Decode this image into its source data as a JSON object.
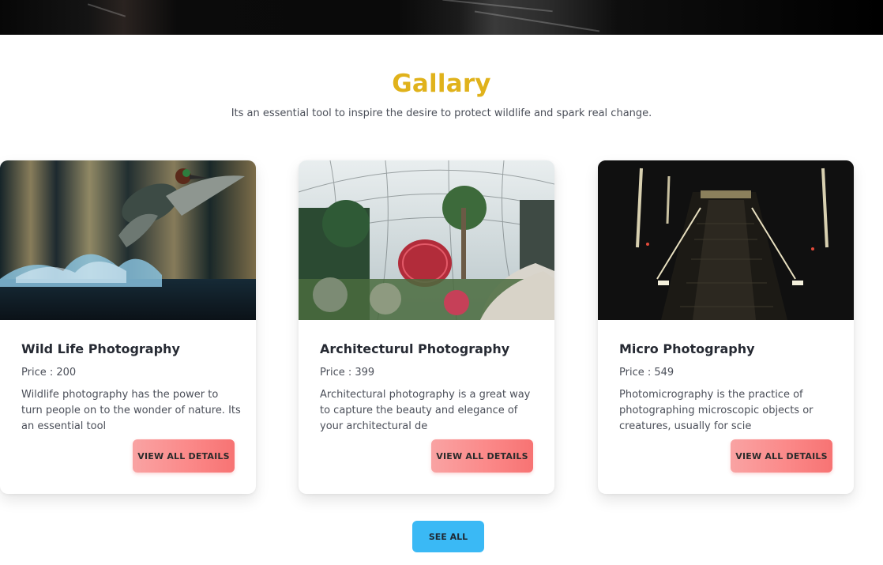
{
  "gallery": {
    "title": "Gallary",
    "subtitle": "Its an essential tool to inspire the desire to protect wildlife and spark real change."
  },
  "cards": [
    {
      "title": "Wild Life Photography",
      "price": "Price : 200",
      "description": "Wildlife photography has the power to turn people on to the wonder of nature. Its an essential tool",
      "button_label": "VIEW ALL DETAILS",
      "image": "duck-splash-photo"
    },
    {
      "title": "Architecturul Photography",
      "price": "Price : 399",
      "description": "Architectural photography is a great way to capture the beauty and elegance of your architectural de",
      "button_label": "VIEW ALL DETAILS",
      "image": "greenhouse-dome-photo"
    },
    {
      "title": "Micro Photography",
      "price": "Price : 549",
      "description": "Photomicrography is the practice of photographing microscopic objects or creatures, usually for scie",
      "button_label": "VIEW ALL DETAILS",
      "image": "dark-stairway-photo"
    }
  ],
  "footer": {
    "see_all_label": "SEE ALL"
  },
  "colors": {
    "heading": "#e0b21b",
    "details_button": "#fb8989",
    "see_all_button": "#3ab9f5"
  }
}
